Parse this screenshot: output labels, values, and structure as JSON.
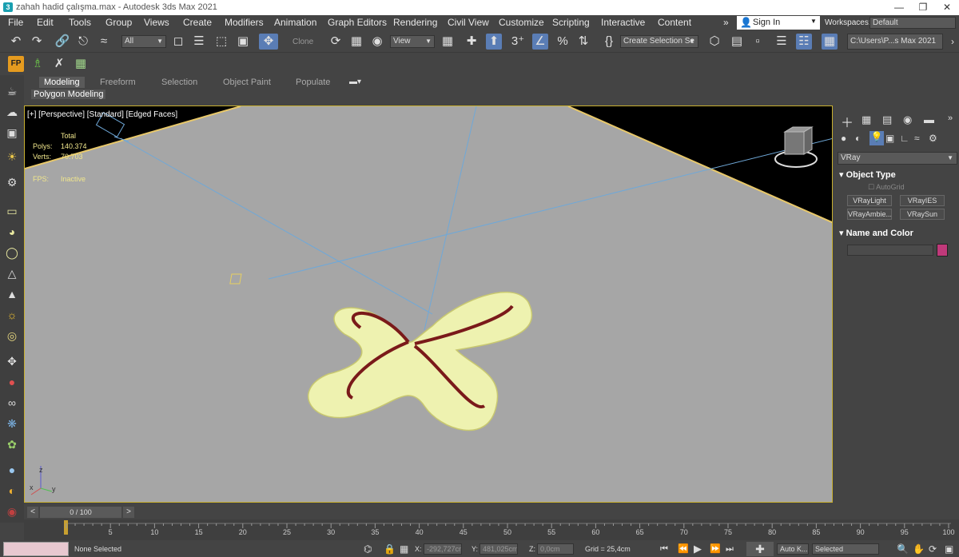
{
  "window": {
    "title": "zahah hadid çalışma.max - Autodesk 3ds Max 2021",
    "app_icon": "3"
  },
  "menu": [
    "File",
    "Edit",
    "Tools",
    "Group",
    "Views",
    "Create",
    "Modifiers",
    "Animation",
    "Graph Editors",
    "Rendering",
    "Civil View",
    "Customize",
    "Scripting",
    "Interactive",
    "Content"
  ],
  "account": {
    "sign_in": "Sign In",
    "workspaces_label": "Workspaces:",
    "workspace_value": "Default",
    "overflow": "»"
  },
  "toolbar": {
    "selection_filter": "All",
    "clone_label": "Clone",
    "ref_coord": "View",
    "named_selection": "Create Selection Se",
    "project_path": "C:\\Users\\P...s Max 2021"
  },
  "ribbon": {
    "tabs": [
      "Modeling",
      "Freeform",
      "Selection",
      "Object Paint",
      "Populate"
    ],
    "active_tab": "Modeling",
    "panel_label": "Polygon Modeling"
  },
  "viewport": {
    "label": "[+] [Perspective] [Standard] [Edged Faces]",
    "stats": {
      "total_label": "Total",
      "polys_label": "Polys:",
      "polys_value": "140.374",
      "verts_label": "Verts:",
      "verts_value": "70.703",
      "fps_label": "FPS:",
      "fps_value": "Inactive"
    },
    "axis": {
      "x": "x",
      "y": "y",
      "z": "z"
    }
  },
  "command_panel": {
    "category": "VRay",
    "object_type_title": "Object Type",
    "autogrid": "AutoGrid",
    "buttons": [
      "VRayLight",
      "VRayIES",
      "VRayAmbie...",
      "VRaySun"
    ],
    "name_color_title": "Name and Color",
    "color_swatch": "#c0397a"
  },
  "timeline": {
    "frame_display": "0 / 100",
    "prev": "<",
    "next": ">",
    "ticks": [
      "5",
      "10",
      "15",
      "20",
      "25",
      "30",
      "35",
      "40",
      "45",
      "50",
      "55",
      "60",
      "65",
      "70",
      "75",
      "80",
      "85",
      "90",
      "95",
      "100"
    ]
  },
  "status": {
    "selection": "None Selected",
    "x_label": "X:",
    "x_value": "-292,727cm",
    "y_label": "Y:",
    "y_value": "481,025cm",
    "z_label": "Z:",
    "z_value": "0,0cm",
    "grid": "Grid = 25,4cm",
    "auto_key": "Auto K...",
    "key_mode": "Selected"
  },
  "colors": {
    "accent": "#5a7db5",
    "viewport_bg": "#a6a6a6",
    "wire": "#f5f5b0",
    "interior": "#7a1a1a"
  }
}
